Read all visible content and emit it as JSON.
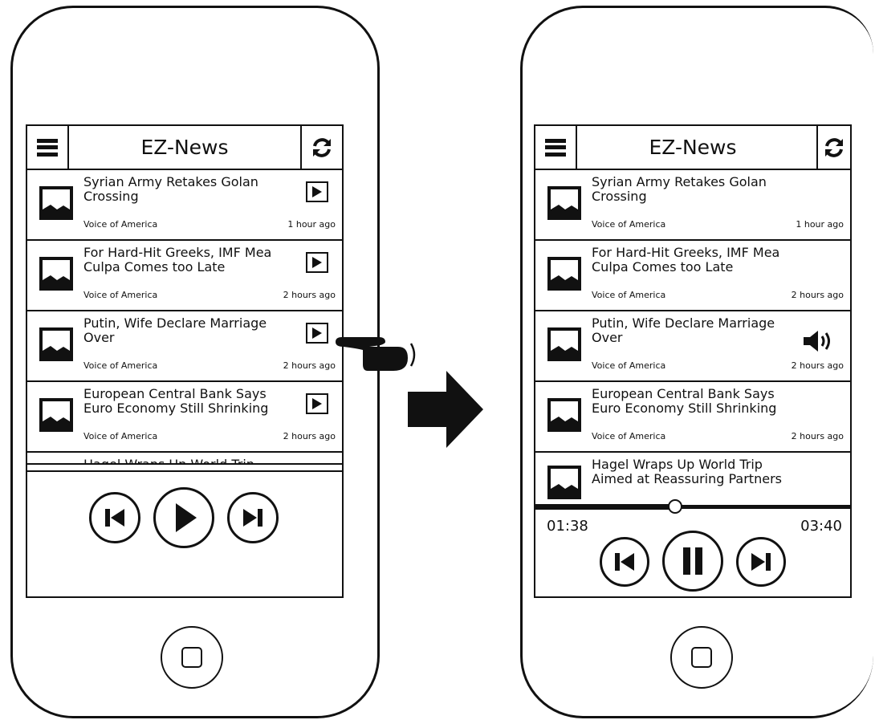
{
  "app": {
    "title": "EZ-News"
  },
  "articles": [
    {
      "headline": "Syrian Army Retakes Golan Crossing",
      "source": "Voice of America",
      "time": "1 hour ago"
    },
    {
      "headline": "For Hard-Hit Greeks, IMF Mea Culpa Comes too Late",
      "source": "Voice of America",
      "time": "2 hours ago"
    },
    {
      "headline": "Putin, Wife Declare Marriage Over",
      "source": "Voice of America",
      "time": "2 hours ago"
    },
    {
      "headline": "European Central Bank Says Euro Economy Still Shrinking",
      "source": "Voice of America",
      "time": "2 hours ago"
    },
    {
      "headline": "Hagel Wraps Up World Trip Aimed at Reassuring Partners",
      "source": "",
      "time": ""
    }
  ],
  "player": {
    "elapsed": "01:38",
    "duration": "03:40",
    "progress_fraction": 0.445
  },
  "icons": {
    "menu": "hamburger-icon",
    "refresh": "refresh-icon",
    "thumbnail": "image-icon",
    "play": "play-icon",
    "playing": "speaker-icon",
    "previous": "skip-previous-icon",
    "next": "skip-next-icon",
    "pause": "pause-icon",
    "home": "home-icon",
    "tap": "pointing-hand-icon",
    "transition": "right-arrow-icon"
  }
}
